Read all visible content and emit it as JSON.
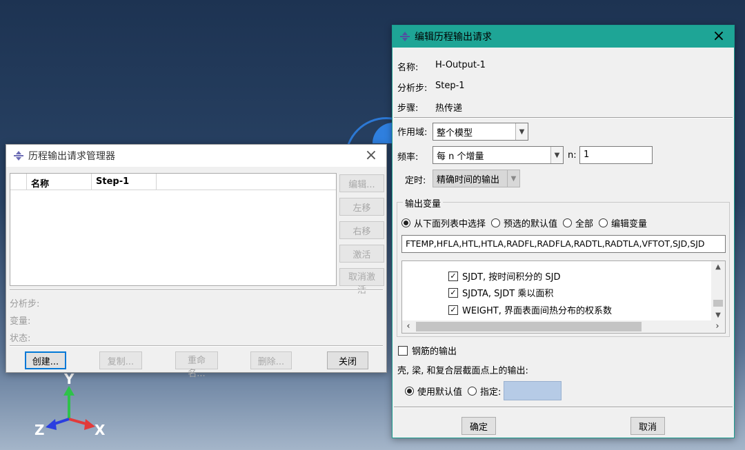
{
  "manager": {
    "title": "历程输出请求管理器",
    "columns": [
      "名称",
      "Step-1"
    ],
    "side_buttons": [
      "编辑...",
      "左移",
      "右移",
      "激活",
      "取消激活"
    ],
    "info": {
      "step_label": "分析步:",
      "variable_label": "变量:",
      "status_label": "状态:"
    },
    "bottom_buttons": {
      "create": "创建...",
      "copy": "复制...",
      "rename": "重命名...",
      "delete": "删除...",
      "close": "关闭"
    }
  },
  "editor": {
    "title": "编辑历程输出请求",
    "name_label": "名称:",
    "name_value": "H-Output-1",
    "step_label": "分析步:",
    "step_value": "Step-1",
    "procedure_label": "步骤:",
    "procedure_value": "热传递",
    "domain_label": "作用域:",
    "domain_value": "整个模型",
    "freq_label": "频率:",
    "freq_value": "每 n 个增量",
    "n_label": "n:",
    "n_value": "1",
    "timing_label": "定时:",
    "timing_value": "精确时间的输出",
    "output_vars": {
      "group_title": "输出变量",
      "options": [
        "从下面列表中选择",
        "预选的默认值",
        "全部",
        "编辑变量"
      ],
      "selected": "从下面列表中选择",
      "vars_text": "FTEMP,HFLA,HTL,HTLA,RADFL,RADFLA,RADTL,RADTLA,VFTOT,SJD,SJD",
      "items": [
        {
          "label": "SJDT, 按时间积分的 SJD",
          "checked": true
        },
        {
          "label": "SJDTA, SJDT 乘以面积",
          "checked": true
        },
        {
          "label": "WEIGHT, 界面表面间热分布的权系数",
          "checked": true
        }
      ]
    },
    "rebar_label": "钢筋的输出",
    "shell_label": "壳, 梁, 和复合层截面点上的输出:",
    "shell_options": {
      "default": "使用默认值",
      "specify": "指定:"
    },
    "ok_label": "确定",
    "cancel_label": "取消"
  },
  "triad": {
    "x": "X",
    "y": "Y",
    "z": "Z"
  },
  "colors": {
    "teal_titlebar": "#1ea596",
    "viewport_bg": "#1d3352",
    "model_blue": "#2f7fde"
  }
}
